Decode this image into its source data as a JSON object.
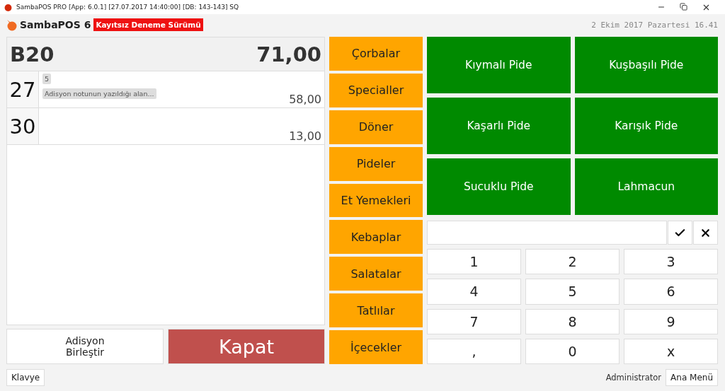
{
  "window": {
    "title": "SambaPOS PRO [App: 6.0.1] [27.07.2017 14:40:00] [DB: 143-143] SQ"
  },
  "header": {
    "brand": "SambaPOS 6",
    "badge": "Kayıtsız Deneme Sürümü",
    "datetime": "2 Ekim 2017 Pazartesi 16.41"
  },
  "ticket": {
    "table": "B20",
    "total": "71,00",
    "lines": [
      {
        "number": "27",
        "tags": [
          "5",
          "Adisyon notunun yazıldığı alan..."
        ],
        "amount": "58,00"
      },
      {
        "number": "30",
        "amount": "13,00"
      }
    ]
  },
  "actions": [
    {
      "label": "Adisyon Birleştir",
      "kind": "plain"
    },
    {
      "label": "Kapat",
      "kind": "close"
    }
  ],
  "categories": [
    "Çorbalar",
    "Specialler",
    "Döner",
    "Pideler",
    "Et Yemekleri",
    "Kebaplar",
    "Salatalar",
    "Tatlılar",
    "İçecekler"
  ],
  "products": [
    "Kıymalı Pide",
    "Kuşbaşılı Pide",
    "Kaşarlı Pide",
    "Karışık Pide",
    "Sucuklu Pide",
    "Lahmacun"
  ],
  "keypad": [
    "1",
    "2",
    "3",
    "4",
    "5",
    "6",
    "7",
    "8",
    "9",
    ",",
    "0",
    "x"
  ],
  "footer": {
    "keyboard": "Klavye",
    "user": "Administrator",
    "menu": "Ana Menü"
  }
}
